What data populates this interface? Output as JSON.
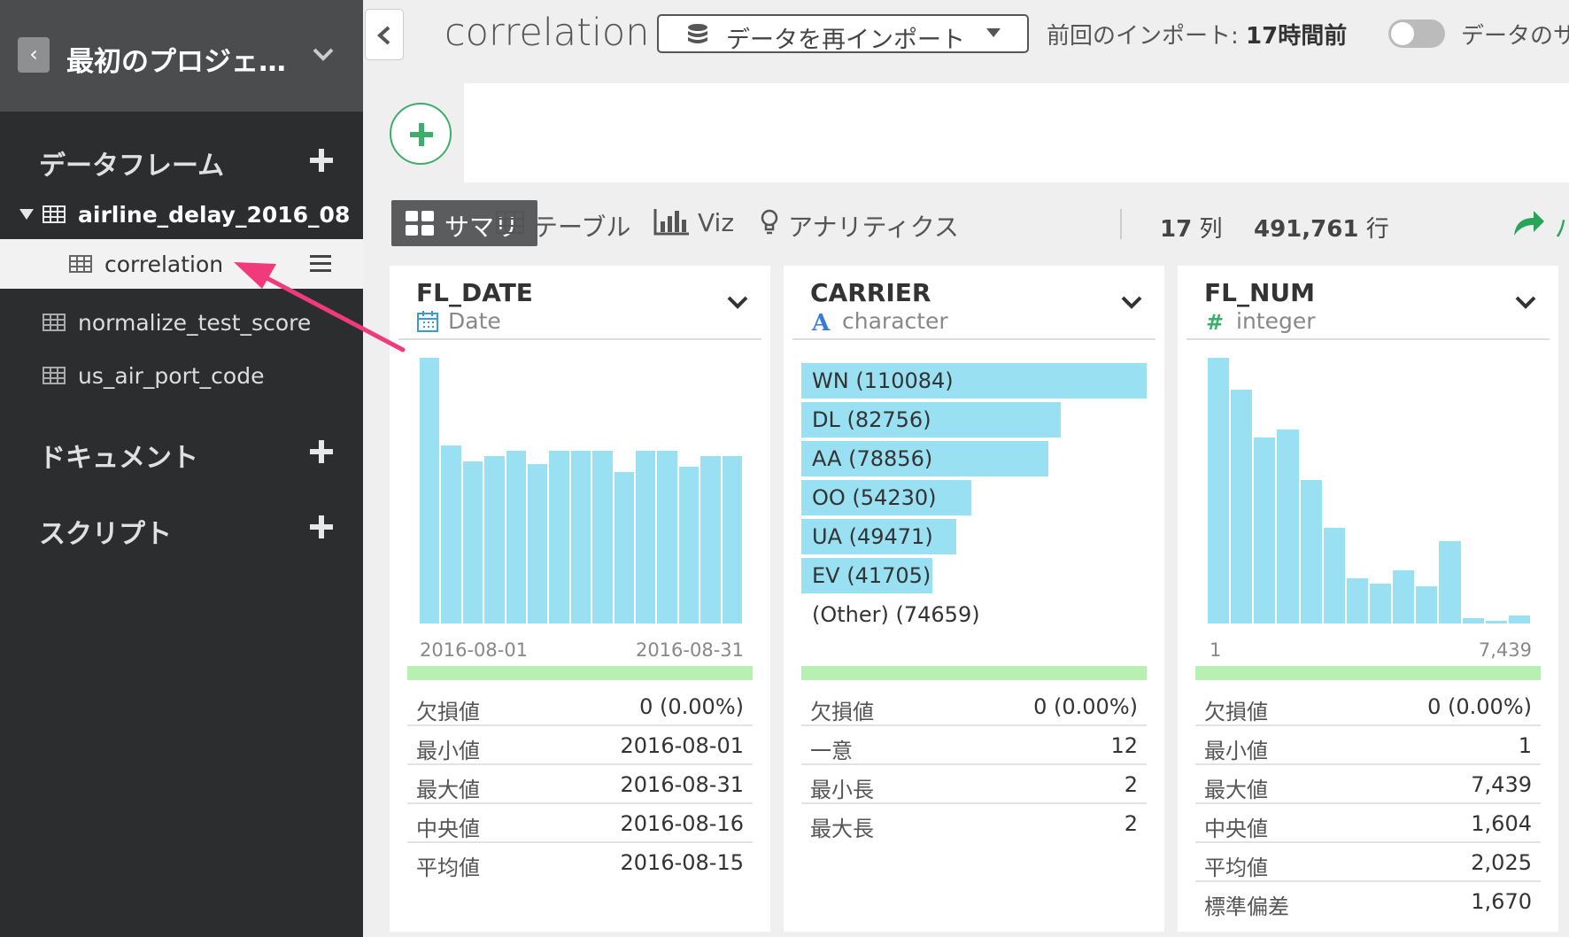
{
  "project": {
    "name": "最初のプロジェ…"
  },
  "sidebar": {
    "sections": {
      "dataframes": "データフレーム",
      "documents": "ドキュメント",
      "scripts": "スクリプト"
    },
    "parent_df": "airline_delay_2016_08",
    "items": [
      {
        "label": "correlation"
      },
      {
        "label": "normalize_test_score"
      },
      {
        "label": "us_air_port_code"
      }
    ]
  },
  "header": {
    "title": "correlation",
    "reimport_label": "データを再インポート",
    "last_import_prefix": "前回のインポート: ",
    "last_import_value": "17時間前",
    "sync_label": "データのサ"
  },
  "tabs": {
    "summary": "サマリ",
    "table": "テーブル",
    "viz": "Viz",
    "analytics": "アナリティクス",
    "col_count": "17",
    "col_unit": "列",
    "row_count": "491,761",
    "row_unit": "行",
    "share_label": "パ"
  },
  "colors": {
    "accent_green": "#3cae6a",
    "bar_blue": "#98e0f2",
    "arrow_pink": "#f03a7a"
  },
  "columns": [
    {
      "name": "FL_DATE",
      "type": "Date",
      "icon": "calendar-icon",
      "axis_min": "2016-08-01",
      "axis_max": "2016-08-31",
      "chart_data": {
        "type": "bar",
        "values": [
          100,
          67,
          61,
          63,
          65,
          60,
          65,
          65,
          65,
          57,
          65,
          65,
          59,
          63,
          63
        ]
      },
      "stats": [
        {
          "k": "欠損値",
          "v": "0 (0.00%)"
        },
        {
          "k": "最小値",
          "v": "2016-08-01"
        },
        {
          "k": "最大値",
          "v": "2016-08-31"
        },
        {
          "k": "中央値",
          "v": "2016-08-16"
        },
        {
          "k": "平均値",
          "v": "2016-08-15"
        }
      ]
    },
    {
      "name": "CARRIER",
      "type": "character",
      "icon": "character-icon",
      "categories": [
        {
          "label": "WN (110084)",
          "value": 110084
        },
        {
          "label": "DL (82756)",
          "value": 82756
        },
        {
          "label": "AA (78856)",
          "value": 78856
        },
        {
          "label": "OO (54230)",
          "value": 54230
        },
        {
          "label": "UA (49471)",
          "value": 49471
        },
        {
          "label": "EV (41705)",
          "value": 41705
        },
        {
          "label": "(Other) (74659)",
          "value": 0
        }
      ],
      "stats": [
        {
          "k": "欠損値",
          "v": "0 (0.00%)"
        },
        {
          "k": "一意",
          "v": "12"
        },
        {
          "k": "最小長",
          "v": "2"
        },
        {
          "k": "最大長",
          "v": "2"
        }
      ]
    },
    {
      "name": "FL_NUM",
      "type": "integer",
      "icon": "integer-icon",
      "axis_min": "1",
      "axis_max": "7,439",
      "chart_data": {
        "type": "bar",
        "values": [
          100,
          88,
          70,
          73,
          54,
          36,
          17,
          15,
          20,
          14,
          31,
          2,
          1,
          3
        ]
      },
      "stats": [
        {
          "k": "欠損値",
          "v": "0 (0.00%)"
        },
        {
          "k": "最小値",
          "v": "1"
        },
        {
          "k": "最大値",
          "v": "7,439"
        },
        {
          "k": "中央値",
          "v": "1,604"
        },
        {
          "k": "平均値",
          "v": "2,025"
        },
        {
          "k": "標準偏差",
          "v": "1,670"
        }
      ]
    }
  ]
}
